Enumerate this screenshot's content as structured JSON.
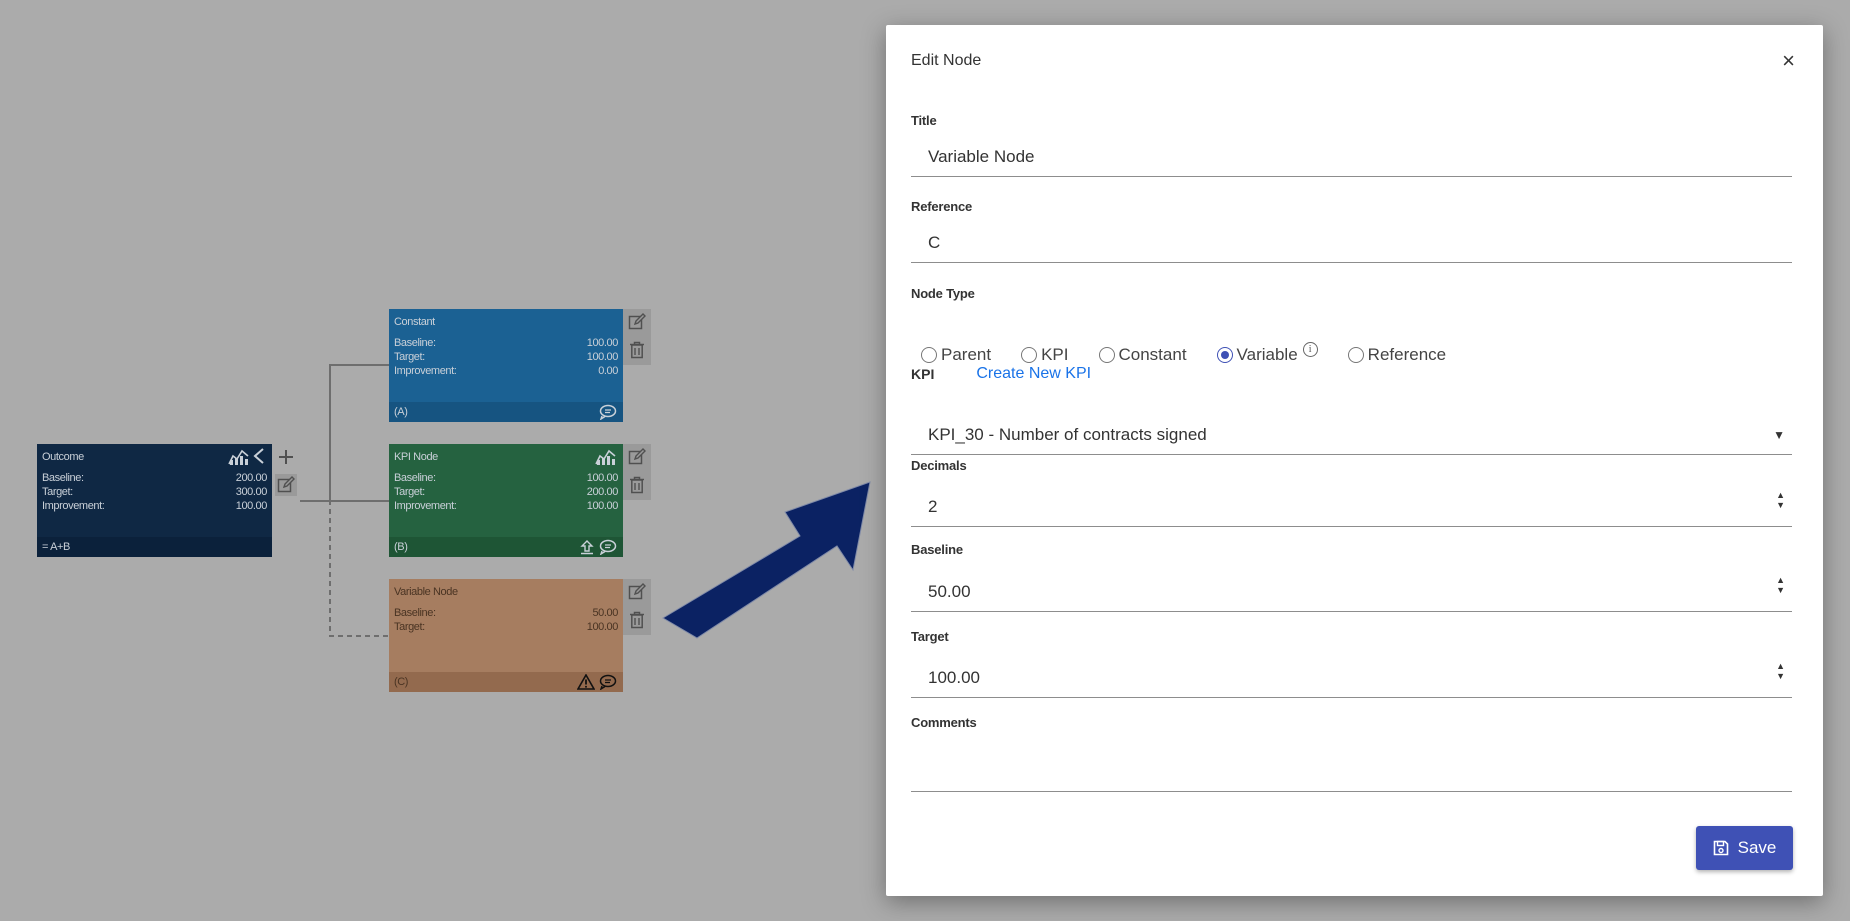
{
  "tree": {
    "outcome": {
      "title": "Outcome",
      "rows": [
        {
          "label": "Baseline:",
          "value": "200.00"
        },
        {
          "label": "Target:",
          "value": "300.00"
        },
        {
          "label": "Improvement:",
          "value": "100.00"
        }
      ],
      "footer": "= A+B"
    },
    "constant": {
      "title": "Constant",
      "rows": [
        {
          "label": "Baseline:",
          "value": "100.00"
        },
        {
          "label": "Target:",
          "value": "100.00"
        },
        {
          "label": "Improvement:",
          "value": "0.00"
        }
      ],
      "footer": "(A)"
    },
    "kpi": {
      "title": "KPI Node",
      "rows": [
        {
          "label": "Baseline:",
          "value": "100.00"
        },
        {
          "label": "Target:",
          "value": "200.00"
        },
        {
          "label": "Improvement:",
          "value": "100.00"
        }
      ],
      "footer": "(B)"
    },
    "variable": {
      "title": "Variable Node",
      "rows": [
        {
          "label": "Baseline:",
          "value": "50.00"
        },
        {
          "label": "Target:",
          "value": "100.00"
        }
      ],
      "footer": "(C)"
    }
  },
  "colors": {
    "outcome": "#0f2844",
    "constant": "#1b6193",
    "kpi": "#256240",
    "variable": "#a67d60",
    "arrow": "#0b2263",
    "primary": "#3f51b5",
    "link": "#1a73e8"
  },
  "modal": {
    "title": "Edit Node",
    "close": "×",
    "title_label": "Title",
    "title_value": "Variable Node",
    "reference_label": "Reference",
    "reference_value": "C",
    "node_type_label": "Node Type",
    "node_types": [
      "Parent",
      "KPI",
      "Constant",
      "Variable",
      "Reference"
    ],
    "node_type_selected": "Variable",
    "kpi_label": "KPI",
    "create_kpi_link": "Create New KPI",
    "kpi_selected": "KPI_30 - Number of contracts signed",
    "decimals_label": "Decimals",
    "decimals_value": "2",
    "baseline_label": "Baseline",
    "baseline_value": "50.00",
    "target_label": "Target",
    "target_value": "100.00",
    "comments_label": "Comments",
    "comments_value": "",
    "save_label": "Save"
  }
}
